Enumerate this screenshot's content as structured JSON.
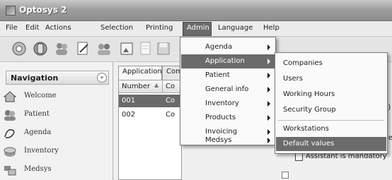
{
  "window": {
    "title": "Optosys 2"
  },
  "menubar": {
    "items": [
      "File",
      "Edit",
      "Actions",
      "Selection",
      "Printing",
      "Admin",
      "Language",
      "Help"
    ],
    "active": "Admin"
  },
  "toolbar": {
    "icons": [
      "new-record-icon",
      "settings-icon",
      "people-icon",
      "edit-document-icon",
      "group-icon",
      "image-icon",
      "document-icon",
      "save-icon"
    ]
  },
  "navigation": {
    "title": "Navigation",
    "collapse_glyph": "«",
    "items": [
      {
        "label": "Welcome",
        "icon": "home-icon"
      },
      {
        "label": "Patient",
        "icon": "patient-icon"
      },
      {
        "label": "Agenda",
        "icon": "agenda-icon"
      },
      {
        "label": "Inventory",
        "icon": "inventory-icon"
      },
      {
        "label": "Medsys",
        "icon": "medsys-icon"
      }
    ]
  },
  "main": {
    "tabs": [
      "Application",
      "Com"
    ],
    "grid": {
      "columns": [
        "Number",
        "Co"
      ],
      "rows": [
        {
          "number": "001",
          "co": "Co",
          "selected": true
        },
        {
          "number": "002",
          "co": "Co",
          "selected": false
        }
      ]
    }
  },
  "admin_menu": {
    "items": [
      {
        "label": "Agenda",
        "submenu": true
      },
      {
        "label": "Application",
        "submenu": true,
        "highlighted": true
      },
      {
        "label": "Patient",
        "submenu": true
      },
      {
        "label": "General info",
        "submenu": true
      },
      {
        "label": "Inventory",
        "submenu": true
      },
      {
        "label": "Products",
        "submenu": true
      },
      {
        "label": "Invoicing",
        "submenu": true
      },
      {
        "label": "Medsys",
        "submenu": true
      }
    ]
  },
  "application_submenu": {
    "items": [
      {
        "label": "Companies"
      },
      {
        "label": "Users"
      },
      {
        "label": "Working Hours"
      },
      {
        "label": "Security Group"
      },
      {
        "label": "Workstations"
      },
      {
        "label": "Default values",
        "highlighted": true
      }
    ]
  },
  "right_panel": {
    "checkbox_label": "Assistant is mandatory",
    "fragment_1": "2)",
    "fragment_2": "ve"
  },
  "colors": {
    "highlight": "#6b6b6b",
    "menu_bg": "#fafafa",
    "titlebar": "#9c9c9c"
  }
}
